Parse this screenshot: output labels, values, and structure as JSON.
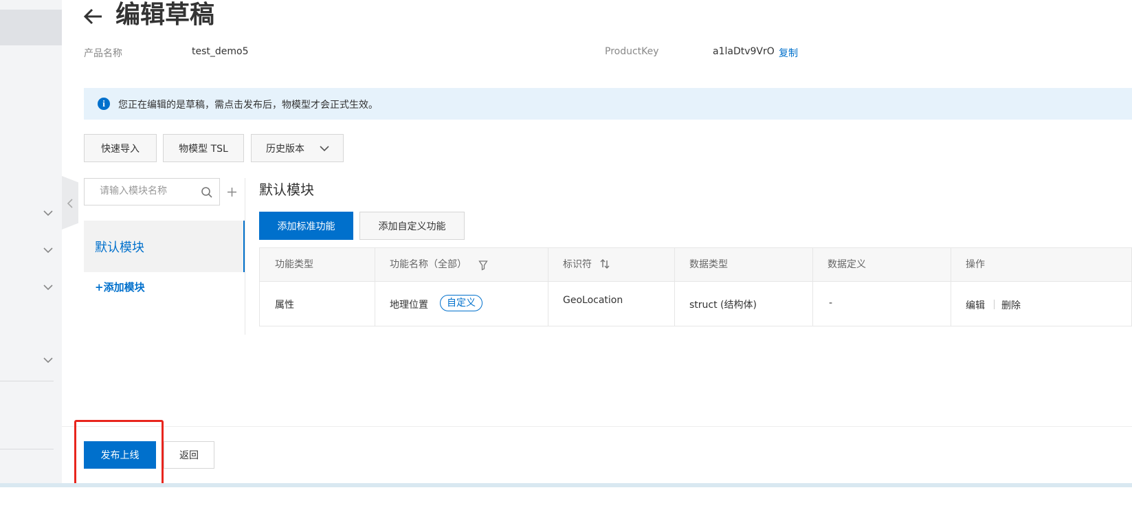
{
  "header": {
    "title": "编辑草稿",
    "product_name_label": "产品名称",
    "product_name_value": "test_demo5",
    "product_key_label": "ProductKey",
    "product_key_value": "a1laDtv9VrO",
    "copy_label": "复制"
  },
  "notice": {
    "text": "您正在编辑的是草稿，需点击发布后，物模型才会正式生效。"
  },
  "toolbar": {
    "quick_import": "快速导入",
    "tsl": "物模型 TSL",
    "history": "历史版本"
  },
  "modules": {
    "search_placeholder": "请输入模块名称",
    "items": [
      {
        "label": "默认模块"
      }
    ],
    "add_module": "+添加模块"
  },
  "main": {
    "section_title": "默认模块",
    "add_standard": "添加标准功能",
    "add_custom": "添加自定义功能"
  },
  "table": {
    "columns": [
      "功能类型",
      "功能名称（全部）",
      "标识符",
      "数据类型",
      "数据定义",
      "操作"
    ],
    "rows": [
      {
        "type": "属性",
        "name": "地理位置",
        "tag": "自定义",
        "identifier": "GeoLocation",
        "data_type": "struct (结构体)",
        "definition": "-",
        "edit": "编辑",
        "delete": "删除"
      }
    ]
  },
  "footer": {
    "publish": "发布上线",
    "back": "返回"
  },
  "colors": {
    "primary": "#0070cc",
    "notice_bg": "#e6f2fb",
    "highlight": "#e8251d"
  },
  "icons": [
    "back-arrow-icon",
    "info-icon",
    "chevron-down-icon",
    "search-icon",
    "plus-icon",
    "filter-icon",
    "sort-icon",
    "chevron-left-icon"
  ]
}
